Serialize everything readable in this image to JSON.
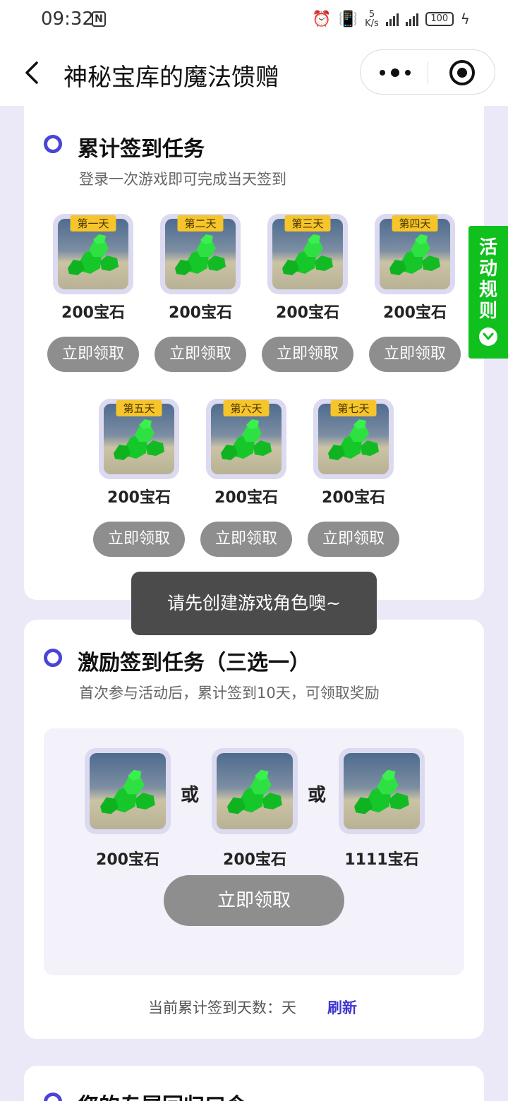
{
  "status_bar": {
    "time": "09:32",
    "nfc": "N",
    "speed_top": "5",
    "speed_bottom": "K/s",
    "battery": "100"
  },
  "header": {
    "title": "神秘宝库的魔法馈赠"
  },
  "section1": {
    "title": "累计签到任务",
    "subtitle": "登录一次游戏即可完成当天签到",
    "items": [
      {
        "day": "第一天",
        "reward": "200宝石",
        "button": "立即领取"
      },
      {
        "day": "第二天",
        "reward": "200宝石",
        "button": "立即领取"
      },
      {
        "day": "第三天",
        "reward": "200宝石",
        "button": "立即领取"
      },
      {
        "day": "第四天",
        "reward": "200宝石",
        "button": "立即领取"
      },
      {
        "day": "第五天",
        "reward": "200宝石",
        "button": "立即领取"
      },
      {
        "day": "第六天",
        "reward": "200宝石",
        "button": "立即领取"
      },
      {
        "day": "第七天",
        "reward": "200宝石",
        "button": "立即领取"
      }
    ]
  },
  "toast": "请先创建游戏角色噢~",
  "side_tab": {
    "label": "活动规则"
  },
  "section2": {
    "title": "激励签到任务（三选一）",
    "subtitle": "首次参与活动后，累计签到10天，可领取奖励",
    "options": [
      {
        "reward": "200宝石"
      },
      {
        "reward": "200宝石"
      },
      {
        "reward": "1111宝石"
      }
    ],
    "or_label": "或",
    "button": "立即领取",
    "streak_text": "当前累计签到天数：天",
    "refresh": "刷新"
  },
  "section3": {
    "title": "您的专属回归口令"
  },
  "colors": {
    "accent": "#4b44d6",
    "side_tab": "#10c01c",
    "button_disabled": "#8e8e8e",
    "badge": "#f5c52b"
  }
}
